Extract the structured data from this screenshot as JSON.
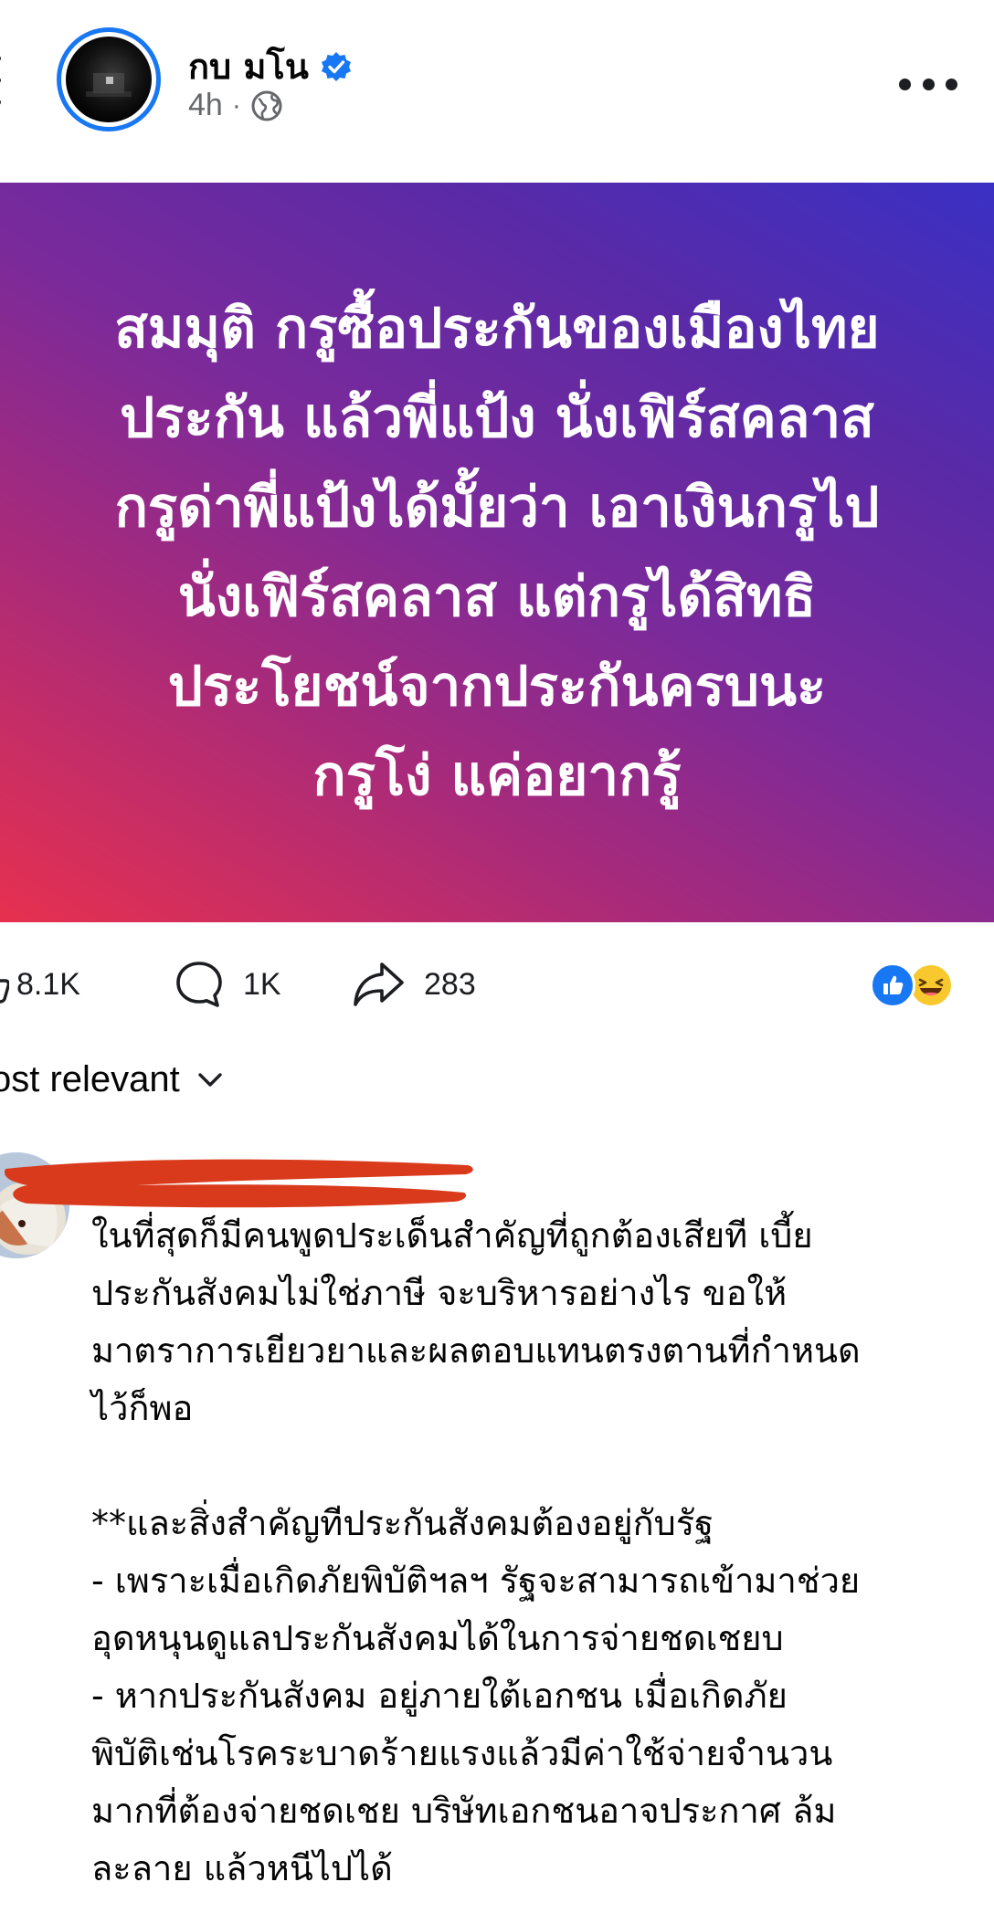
{
  "post": {
    "author": "กบ มโน",
    "time": "4h",
    "banner_lines": [
      "สมมุติ กรูซื้อประกันของเมืองไทย",
      "ประกัน แล้วพี่แป้ง นั่งเฟิร์สคลาส",
      "กรูด่าพี่แป้งได้มั้ยว่า เอาเงินกรูไป",
      "นั่งเฟิร์สคลาส แต่กรูได้สิทธิ",
      "ประโยชน์จากประกันครบนะ",
      "กรูโง่ แค่อยากรู้"
    ],
    "banner_colors": [
      "#e7304f",
      "#7a2a9b",
      "#3a30c4"
    ]
  },
  "stats": {
    "likes": "8.1K",
    "comments": "1K",
    "shares": "283"
  },
  "icons": {
    "like": "like-icon",
    "comment": "comment-icon",
    "share": "share-icon",
    "reaction_like": "like-reaction-icon",
    "reaction_haha": "haha-reaction-icon",
    "more": "more-icon",
    "verified": "verified-badge-icon",
    "audience": "globe-icon",
    "sort": "chevron-down-icon"
  },
  "sort": {
    "label": "ost relevant"
  },
  "comment": {
    "lines": [
      "ในที่สุดก็มีคนพูดประเด็นสำคัญที่ถูกต้องเสียที เบี้ย",
      "ประกันสังคมไม่ใช่ภาษี จะบริหารอย่างไร ขอให้",
      "มาตราการเยียวยาและผลตอบแทนตรงตานที่กำหนด",
      "ไว้ก็พอ",
      "",
      "**และสิ่งสำคัญทีประกันสังคมต้องอยู่กับรัฐ",
      "- เพราะเมื่อเกิดภัยพิบัติฯลฯ รัฐจะสามารถเข้ามาช่วย",
      "อุดหนุนดูแลประกันสังคมได้ในการจ่ายชดเชยบ",
      "- หากประกันสังคม อยู่ภายใต้เอกชน เมื่อเกิดภัย",
      "พิบัติเช่นโรคระบาดร้ายแรงแล้วมีค่าใช้จ่ายจำนวน",
      "มากที่ต้องจ่ายชดเชย บริษัทเอกชนอาจประกาศ ล้ม",
      "ละลาย แล้วหนีไปได้"
    ]
  }
}
